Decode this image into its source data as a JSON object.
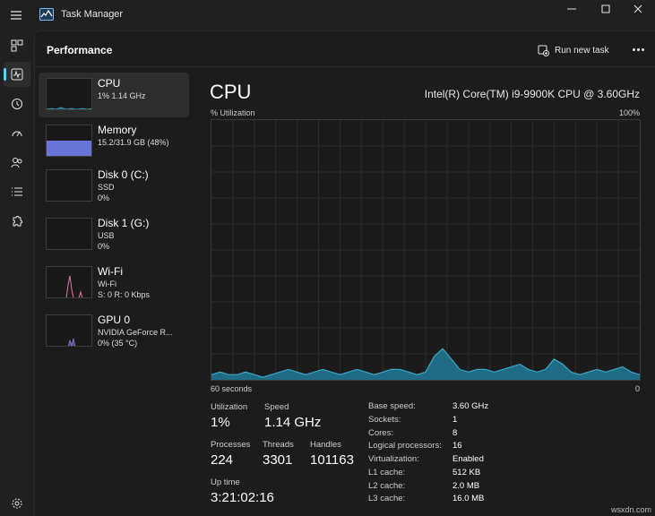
{
  "window": {
    "title": "Task Manager"
  },
  "header": {
    "page_title": "Performance",
    "run_new_task": "Run new task"
  },
  "devices": [
    {
      "name": "CPU",
      "sub1": "1% 1.14 GHz",
      "sub2": ""
    },
    {
      "name": "Memory",
      "sub1": "15.2/31.9 GB (48%)",
      "sub2": ""
    },
    {
      "name": "Disk 0 (C:)",
      "sub1": "SSD",
      "sub2": "0%"
    },
    {
      "name": "Disk 1 (G:)",
      "sub1": "USB",
      "sub2": "0%"
    },
    {
      "name": "Wi-Fi",
      "sub1": "Wi-Fi",
      "sub2": "S: 0 R: 0 Kbps"
    },
    {
      "name": "GPU 0",
      "sub1": "NVIDIA GeForce R...",
      "sub2": "0% (35 °C)"
    }
  ],
  "cpu": {
    "title": "CPU",
    "model": "Intel(R) Core(TM) i9-9900K CPU @ 3.60GHz",
    "util_label": "% Utilization",
    "util_max": "100%",
    "axis_left": "60 seconds",
    "axis_right": "0",
    "history_percent": [
      2,
      3,
      2,
      2,
      3,
      2,
      1,
      2,
      3,
      4,
      3,
      2,
      3,
      4,
      3,
      2,
      3,
      4,
      3,
      2,
      3,
      4,
      4,
      3,
      2,
      3,
      9,
      12,
      8,
      4,
      3,
      4,
      4,
      3,
      4,
      5,
      6,
      4,
      3,
      4,
      8,
      6,
      3,
      2,
      3,
      4,
      3,
      4,
      5,
      3,
      2
    ]
  },
  "stats": {
    "utilization_label": "Utilization",
    "utilization_value": "1%",
    "speed_label": "Speed",
    "speed_value": "1.14 GHz",
    "processes_label": "Processes",
    "processes_value": "224",
    "threads_label": "Threads",
    "threads_value": "3301",
    "handles_label": "Handles",
    "handles_value": "101163",
    "uptime_label": "Up time",
    "uptime_value": "3:21:02:16"
  },
  "specs": [
    {
      "label": "Base speed:",
      "value": "3.60 GHz"
    },
    {
      "label": "Sockets:",
      "value": "1"
    },
    {
      "label": "Cores:",
      "value": "8"
    },
    {
      "label": "Logical processors:",
      "value": "16"
    },
    {
      "label": "Virtualization:",
      "value": "Enabled"
    },
    {
      "label": "L1 cache:",
      "value": "512 KB"
    },
    {
      "label": "L2 cache:",
      "value": "2.0 MB"
    },
    {
      "label": "L3 cache:",
      "value": "16.0 MB"
    }
  ],
  "watermark": "wsxdn.com",
  "colors": {
    "cpu_line": "#3aa6c7",
    "cpu_fill": "#1f6c84",
    "memory": "#6a73d6",
    "disk": "#3d8a5a",
    "wifi": "#e07aa8",
    "gpu": "#8c79c9",
    "accent": "#60cdff"
  }
}
